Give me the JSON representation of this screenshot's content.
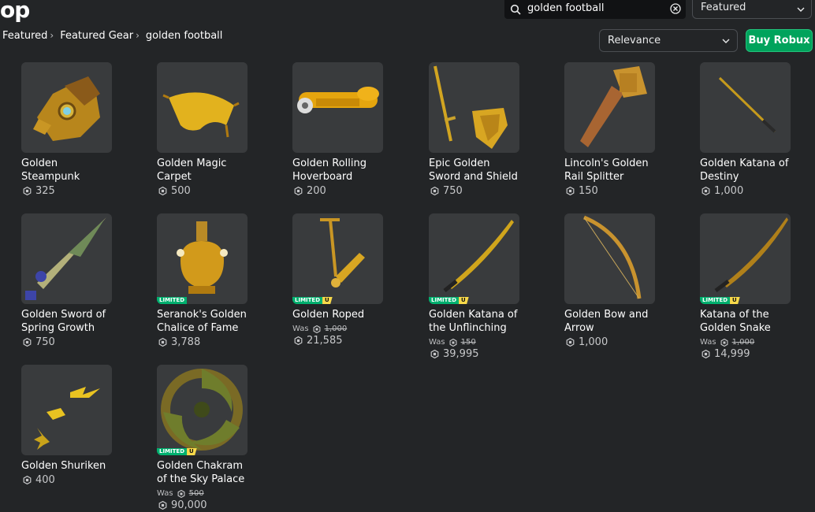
{
  "header": {
    "logo_partial": "op",
    "search_value": "golden football",
    "sort_top": "Featured"
  },
  "breadcrumb": [
    "Featured",
    "Featured Gear",
    "golden football"
  ],
  "toolbar": {
    "sort": "Relevance",
    "buy_robux": "Buy Robux"
  },
  "labels": {
    "limited": "LIMITED",
    "u": "U",
    "was": "Was"
  },
  "colors": {
    "background": "#232527",
    "thumb": "#393b3d",
    "buy_button": "#00a35c",
    "limited": "#00b06f",
    "unique": "#f8d94a"
  },
  "items": [
    {
      "line1": "Golden",
      "line2": "Steampunk",
      "price": "325",
      "limited": false
    },
    {
      "line1": "Golden Magic",
      "line2": "Carpet",
      "price": "500",
      "limited": false
    },
    {
      "line1": "Golden Rolling",
      "line2": "Hoverboard",
      "price": "200",
      "limited": false
    },
    {
      "line1": "Epic Golden",
      "line2": "Sword and Shield",
      "price": "750",
      "limited": false
    },
    {
      "line1": "Lincoln's Golden",
      "line2": "Rail Splitter",
      "price": "150",
      "limited": false
    },
    {
      "line1": "Golden Katana of",
      "line2": "Destiny",
      "price": "1,000",
      "limited": false
    },
    {
      "line1": "Golden Sword of",
      "line2": "Spring Growth",
      "price": "750",
      "limited": false
    },
    {
      "line1": "Seranok's Golden",
      "line2": "Chalice of Fame",
      "price": "3,788",
      "limited": true,
      "unique": false
    },
    {
      "line1": "Golden Roped",
      "line2": "",
      "price": "21,585",
      "limited": true,
      "unique": true,
      "was": "1,000"
    },
    {
      "line1": "Golden Katana of",
      "line2": "the Unflinching",
      "price": "39,995",
      "limited": true,
      "unique": true,
      "was": "150"
    },
    {
      "line1": "Golden Bow and",
      "line2": "Arrow",
      "price": "1,000",
      "limited": false
    },
    {
      "line1": "Katana of the",
      "line2": "Golden Snake",
      "price": "14,999",
      "limited": true,
      "unique": true,
      "was": "1,000"
    },
    {
      "line1": "Golden Shuriken",
      "line2": "",
      "price": "400",
      "limited": false
    },
    {
      "line1": "Golden Chakram",
      "line2": "of the Sky Palace",
      "price": "90,000",
      "limited": true,
      "unique": true,
      "was": "500"
    }
  ]
}
